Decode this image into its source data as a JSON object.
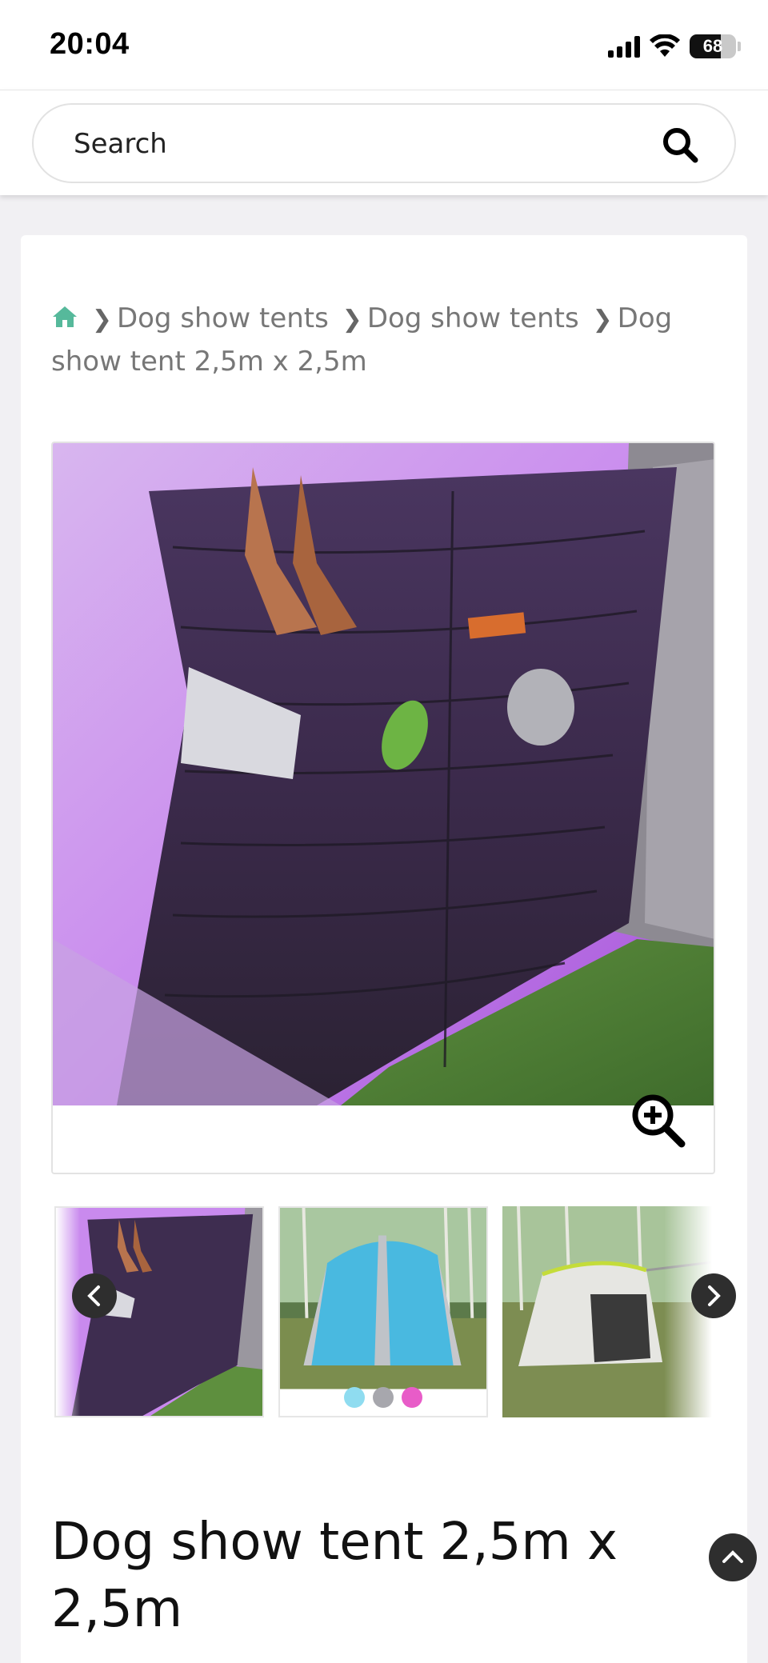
{
  "status_bar": {
    "time": "20:04",
    "battery_percent": "68",
    "battery_level": 0.68,
    "signal_bars": 4
  },
  "search": {
    "placeholder": "Search",
    "icon": "search-icon"
  },
  "breadcrumb": {
    "home_icon": "home-icon",
    "items": [
      "Dog show tents",
      "Dog show tents",
      "Dog show tent 2,5m x 2,5m"
    ]
  },
  "gallery": {
    "main_image": "tent-organizer-photo",
    "zoom_icon": "zoom-in-icon",
    "thumbnails": [
      {
        "name": "tent-organizer-thumb",
        "selected": true
      },
      {
        "name": "blue-tent-thumb",
        "swatches": [
          "#8fdcf0",
          "#a7a7ad",
          "#e85cc8"
        ]
      },
      {
        "name": "white-tent-thumb"
      }
    ],
    "prev_icon": "chevron-left-icon",
    "next_icon": "chevron-right-icon"
  },
  "product": {
    "title": "Dog show tent 2,5m x 2,5m"
  },
  "colors": {
    "accent_home": "#56b99b",
    "dark_button": "#2e2e2e",
    "background": "#f1f0f3"
  }
}
